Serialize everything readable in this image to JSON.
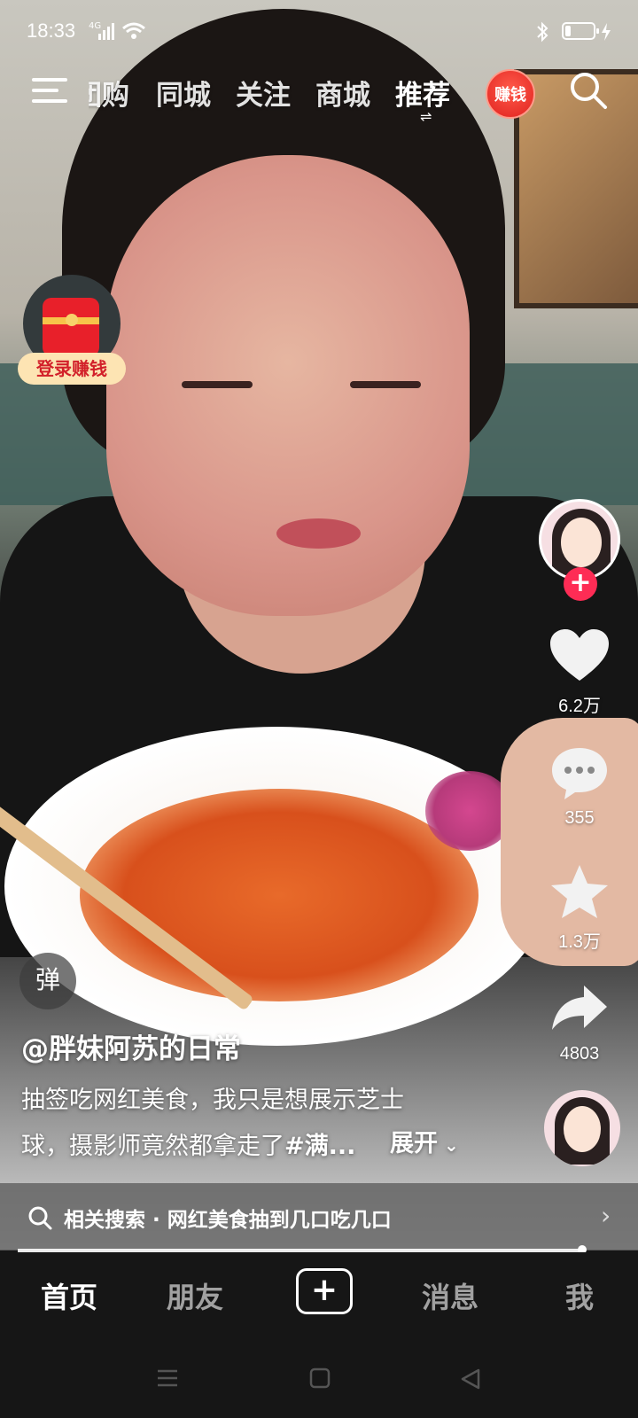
{
  "status_bar": {
    "time": "18:33",
    "network": "4G"
  },
  "top_nav": {
    "tabs": [
      {
        "label": "团购",
        "state": "partially-scrolled"
      },
      {
        "label": "同城"
      },
      {
        "label": "关注"
      },
      {
        "label": "商城"
      },
      {
        "label": "推荐",
        "active": true
      }
    ],
    "earn_badge": "赚钱",
    "icons": [
      "menu-icon",
      "search-icon"
    ]
  },
  "red_packet": {
    "label": "登录赚钱"
  },
  "right_rail": {
    "like_count": "6.2万",
    "comment_count": "355",
    "favorite_count": "1.3万",
    "share_count": "4803"
  },
  "video": {
    "danmu_label": "弹",
    "author": "@胖妹阿苏的日常",
    "description_line1": "抽签吃网红美食，我只是想展示芝士",
    "description_line2_prefix": "球，摄影师竟然都拿走了",
    "description_hashtag": "#满...",
    "expand_label": "展开"
  },
  "related_search": {
    "prefix": "相关搜索 · ",
    "query": "网红美食抽到几口吃几口"
  },
  "bottom_nav": {
    "items": [
      {
        "label": "首页",
        "active": true
      },
      {
        "label": "朋友"
      },
      {
        "label": "+"
      },
      {
        "label": "消息"
      },
      {
        "label": "我"
      }
    ]
  },
  "colors": {
    "accent_red": "#fe2c55",
    "badge_red": "#e0221f",
    "background": "#161616"
  },
  "playback_progress": 0.9
}
